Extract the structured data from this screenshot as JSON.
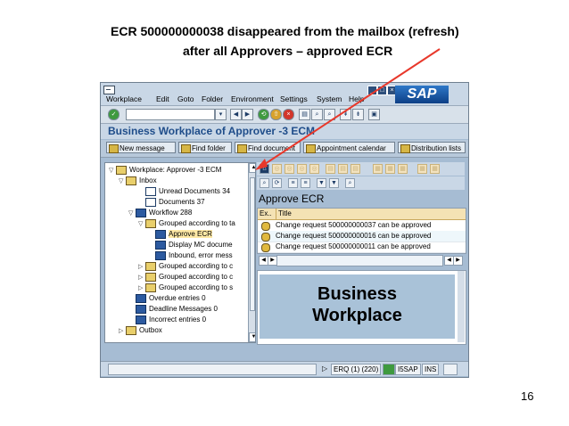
{
  "slide": {
    "caption_line1": "ECR 500000000038 disappeared from the mailbox  (refresh)",
    "caption_line2": "after all Approvers – approved ECR",
    "page_number": "16",
    "arrow_color": "#e8382b"
  },
  "window": {
    "menu": [
      "Workplace",
      "Edit",
      "Goto",
      "Folder",
      "Environment",
      "Settings",
      "System",
      "Help"
    ],
    "logo": "SAP",
    "title": "Business Workplace of Approver -3 ECM",
    "app_buttons": [
      "New message",
      "Find folder",
      "Find document",
      "Appointment calendar",
      "Distribution lists"
    ]
  },
  "tree": {
    "items": [
      {
        "label": "Workplace: Approver -3 ECM",
        "indent": 0,
        "toggle": "▽",
        "icon": "workplace"
      },
      {
        "label": "Inbox",
        "indent": 1,
        "toggle": "▽",
        "icon": "folder"
      },
      {
        "label": "Unread Documents 34",
        "indent": 3,
        "toggle": "",
        "icon": "doc"
      },
      {
        "label": "Documents 37",
        "indent": 3,
        "toggle": "",
        "icon": "doc"
      },
      {
        "label": "Workflow 288",
        "indent": 2,
        "toggle": "▽",
        "icon": "blue"
      },
      {
        "label": "Grouped according to ta",
        "indent": 3,
        "toggle": "▽",
        "icon": "folder"
      },
      {
        "label": "Approve ECR",
        "indent": 4,
        "toggle": "",
        "icon": "sel",
        "highlight": true
      },
      {
        "label": "Display MC docume",
        "indent": 4,
        "toggle": "",
        "icon": "blue"
      },
      {
        "label": "Inbound, error mess",
        "indent": 4,
        "toggle": "",
        "icon": "blue"
      },
      {
        "label": "Grouped according to c",
        "indent": 3,
        "toggle": "▷",
        "icon": "folder"
      },
      {
        "label": "Grouped according to c",
        "indent": 3,
        "toggle": "▷",
        "icon": "folder"
      },
      {
        "label": "Grouped according to s",
        "indent": 3,
        "toggle": "▷",
        "icon": "folder"
      },
      {
        "label": "Overdue entries 0",
        "indent": 2,
        "toggle": "",
        "icon": "blue"
      },
      {
        "label": "Deadline Messages 0",
        "indent": 2,
        "toggle": "",
        "icon": "blue"
      },
      {
        "label": "Incorrect entries 0",
        "indent": 2,
        "toggle": "",
        "icon": "blue"
      },
      {
        "label": "Outbox",
        "indent": 1,
        "toggle": "▷",
        "icon": "folder"
      }
    ]
  },
  "worklist": {
    "title": "Approve ECR",
    "columns": [
      "Ex..",
      "Title"
    ],
    "rows": [
      "Change request 500000000037 can be approved",
      "Change request 500000000016 can be approved",
      "Change request 500000000011 can be approved"
    ]
  },
  "preview": {
    "line1": "Business",
    "line2": "Workplace"
  },
  "status": {
    "system": "ERQ (1) (220)",
    "server": "I5SAP",
    "mode": "INS"
  }
}
